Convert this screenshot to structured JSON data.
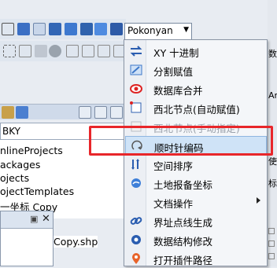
{
  "toolbar": {
    "combo_value": "Pokonyan"
  },
  "path_field": {
    "value": "BKY"
  },
  "tree": {
    "items": [
      "nlineProjects",
      "ackages",
      "ojects",
      "ojectTemplates",
      "一坐标 Copy"
    ]
  },
  "shapefile": {
    "label": "Copy.shp"
  },
  "right_edge": {
    "top_text": "数",
    "label_a": "Ar",
    "label_b": "使",
    "label_c": "标"
  },
  "menu": {
    "items": [
      {
        "label": "XY 十进制",
        "icon": "xy-arrows-icon"
      },
      {
        "label": "分割赋值",
        "icon": "split-assign-icon"
      },
      {
        "label": "数据库合并",
        "icon": "database-merge-icon"
      },
      {
        "label": "西北节点(自动赋值)",
        "icon": "northwest-node-icon"
      },
      {
        "label": "西北节点(手动指定)",
        "icon": "northwest-node-manual-icon"
      },
      {
        "label": "顺时针编码",
        "icon": "clockwise-icon"
      },
      {
        "label": "空间排序",
        "icon": "spatial-sort-icon"
      },
      {
        "label": "土地报备坐标",
        "icon": "land-coords-icon"
      },
      {
        "label": "文档操作",
        "icon": "document-icon"
      },
      {
        "label": "界址点线生成",
        "icon": "link-icon"
      },
      {
        "label": "数据结构修改",
        "icon": "gear-icon"
      },
      {
        "label": "打开插件路径",
        "icon": "location-pin-icon"
      }
    ]
  },
  "colors": {
    "highlight": "#e8262a",
    "selected_bg": "#cfe3f7"
  }
}
